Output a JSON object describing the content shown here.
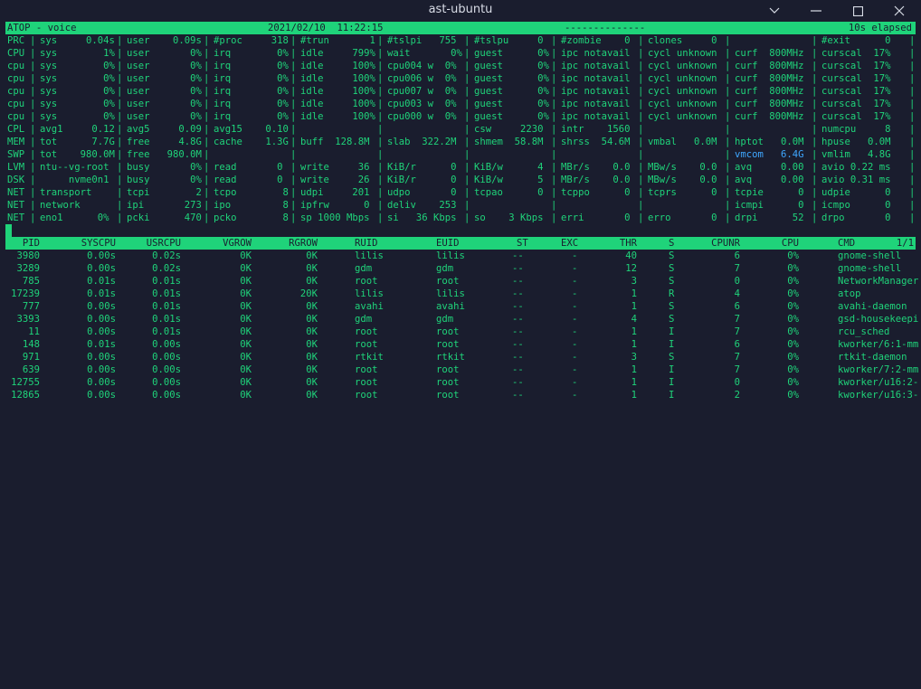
{
  "window": {
    "title": "ast-ubuntu",
    "controls": [
      "chevron-down",
      "minimize",
      "maximize",
      "close"
    ]
  },
  "header": {
    "left": "ATOP - voice",
    "center": "2021/02/10  11:22:15",
    "dashes": "--------------",
    "right": "10s elapsed"
  },
  "sys_rows": [
    [
      "PRC",
      "sys     0.04s",
      "user    0.09s",
      "#proc     318",
      "#trun       1",
      "#tslpi   755",
      "#tslpu     0",
      "#zombie    0",
      "clones     0",
      "",
      "#exit      0"
    ],
    [
      "CPU",
      "sys        1%",
      "user       0%",
      "irq        0%",
      "idle     799%",
      "wait       0%",
      "guest      0%",
      "ipc notavail",
      "cycl unknown",
      "curf  800MHz",
      "curscal  17%"
    ],
    [
      "cpu",
      "sys        0%",
      "user       0%",
      "irq        0%",
      "idle     100%",
      "cpu004 w  0%",
      "guest      0%",
      "ipc notavail",
      "cycl unknown",
      "curf  800MHz",
      "curscal  17%"
    ],
    [
      "cpu",
      "sys        0%",
      "user       0%",
      "irq        0%",
      "idle     100%",
      "cpu006 w  0%",
      "guest      0%",
      "ipc notavail",
      "cycl unknown",
      "curf  800MHz",
      "curscal  17%"
    ],
    [
      "cpu",
      "sys        0%",
      "user       0%",
      "irq        0%",
      "idle     100%",
      "cpu007 w  0%",
      "guest      0%",
      "ipc notavail",
      "cycl unknown",
      "curf  800MHz",
      "curscal  17%"
    ],
    [
      "cpu",
      "sys        0%",
      "user       0%",
      "irq        0%",
      "idle     100%",
      "cpu003 w  0%",
      "guest      0%",
      "ipc notavail",
      "cycl unknown",
      "curf  800MHz",
      "curscal  17%"
    ],
    [
      "cpu",
      "sys        0%",
      "user       0%",
      "irq        0%",
      "idle     100%",
      "cpu000 w  0%",
      "guest      0%",
      "ipc notavail",
      "cycl unknown",
      "curf  800MHz",
      "curscal  17%"
    ],
    [
      "CPL",
      "avg1     0.12",
      "avg5     0.09",
      "avg15    0.10",
      "",
      "",
      "csw     2230",
      "intr    1560",
      "",
      "",
      "numcpu     8"
    ],
    [
      "MEM",
      "tot      7.7G",
      "free     4.8G",
      "cache    1.3G",
      "buff  128.8M",
      "slab  322.2M",
      "shmem  58.8M",
      "shrss  54.6M",
      "vmbal   0.0M",
      "hptot   0.0M",
      "hpuse   0.0M"
    ],
    [
      "SWP",
      "tot    980.0M",
      "free   980.0M",
      "",
      "",
      "",
      "",
      "",
      "",
      "vmcom   6.4G",
      "vmlim   4.8G"
    ],
    [
      "LVM",
      "ntu--vg-root",
      "busy       0%",
      "read       0",
      "write     36",
      "KiB/r      0",
      "KiB/w      4",
      "MBr/s    0.0",
      "MBw/s    0.0",
      "avq     0.00",
      "avio 0.22 ms"
    ],
    [
      "DSK",
      "     nvme0n1",
      "busy       0%",
      "read       0",
      "write     26",
      "KiB/r      0",
      "KiB/w      5",
      "MBr/s    0.0",
      "MBw/s    0.0",
      "avq     0.00",
      "avio 0.31 ms"
    ],
    [
      "NET",
      "transport",
      "tcpi        2",
      "tcpo        8",
      "udpi     201",
      "udpo       0",
      "tcpao      0",
      "tcppo      0",
      "tcprs      0",
      "tcpie      0",
      "udpie      0"
    ],
    [
      "NET",
      "network",
      "ipi       273",
      "ipo         8",
      "ipfrw      0",
      "deliv    253",
      "",
      "",
      "",
      "icmpi      0",
      "icmpo      0"
    ],
    [
      "NET",
      "eno1      0%",
      "pcki      470",
      "pcko        8",
      "sp 1000 Mbps",
      "si   36 Kbps",
      "so    3 Kbps",
      "erri       0",
      "erro       0",
      "drpi      52",
      "drpo       0"
    ]
  ],
  "process_header": [
    "PID",
    "SYSCPU",
    "USRCPU",
    "VGROW",
    "RGROW",
    "RUID",
    "EUID",
    "ST",
    "EXC",
    "THR",
    "S",
    "CPUNR",
    "CPU",
    "CMD",
    "1/1"
  ],
  "processes": [
    [
      "3980",
      "0.00s",
      "0.02s",
      "0K",
      "0K",
      "lilis",
      "lilis",
      "--",
      "-",
      "40",
      "S",
      "6",
      "0%",
      "gnome-shell"
    ],
    [
      "3289",
      "0.00s",
      "0.02s",
      "0K",
      "0K",
      "gdm",
      "gdm",
      "--",
      "-",
      "12",
      "S",
      "7",
      "0%",
      "gnome-shell"
    ],
    [
      "785",
      "0.01s",
      "0.01s",
      "0K",
      "0K",
      "root",
      "root",
      "--",
      "-",
      "3",
      "S",
      "0",
      "0%",
      "NetworkManager"
    ],
    [
      "17239",
      "0.01s",
      "0.01s",
      "0K",
      "20K",
      "lilis",
      "lilis",
      "--",
      "-",
      "1",
      "R",
      "4",
      "0%",
      "atop"
    ],
    [
      "777",
      "0.00s",
      "0.01s",
      "0K",
      "0K",
      "avahi",
      "avahi",
      "--",
      "-",
      "1",
      "S",
      "6",
      "0%",
      "avahi-daemon"
    ],
    [
      "3393",
      "0.00s",
      "0.01s",
      "0K",
      "0K",
      "gdm",
      "gdm",
      "--",
      "-",
      "4",
      "S",
      "7",
      "0%",
      "gsd-housekeepi"
    ],
    [
      "11",
      "0.00s",
      "0.01s",
      "0K",
      "0K",
      "root",
      "root",
      "--",
      "-",
      "1",
      "I",
      "7",
      "0%",
      "rcu_sched"
    ],
    [
      "148",
      "0.01s",
      "0.00s",
      "0K",
      "0K",
      "root",
      "root",
      "--",
      "-",
      "1",
      "I",
      "6",
      "0%",
      "kworker/6:1-mm"
    ],
    [
      "971",
      "0.00s",
      "0.00s",
      "0K",
      "0K",
      "rtkit",
      "rtkit",
      "--",
      "-",
      "3",
      "S",
      "7",
      "0%",
      "rtkit-daemon"
    ],
    [
      "639",
      "0.00s",
      "0.00s",
      "0K",
      "0K",
      "root",
      "root",
      "--",
      "-",
      "1",
      "I",
      "7",
      "0%",
      "kworker/7:2-mm"
    ],
    [
      "12755",
      "0.00s",
      "0.00s",
      "0K",
      "0K",
      "root",
      "root",
      "--",
      "-",
      "1",
      "I",
      "0",
      "0%",
      "kworker/u16:2-"
    ],
    [
      "12865",
      "0.00s",
      "0.00s",
      "0K",
      "0K",
      "root",
      "root",
      "--",
      "-",
      "1",
      "I",
      "2",
      "0%",
      "kworker/u16:3-"
    ]
  ],
  "colors": {
    "background": "#1a1d2e",
    "foreground": "#1fd37a",
    "highlight": "#3fa7ff",
    "titlebar_text": "#d8dce6"
  }
}
